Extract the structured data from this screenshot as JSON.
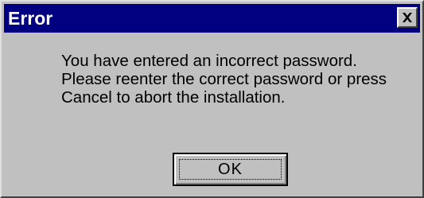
{
  "window": {
    "title": "Error"
  },
  "titlebar": {
    "close_icon": "close-x-icon",
    "color": "#000080"
  },
  "message": {
    "lines": [
      "You have entered an incorrect password.",
      "Please reenter the correct password or press",
      "Cancel to abort the installation."
    ]
  },
  "buttons": {
    "ok_label": "OK"
  },
  "colors": {
    "dialog_face": "#c0c0c0",
    "title_bar": "#000080",
    "title_text": "#ffffff"
  }
}
